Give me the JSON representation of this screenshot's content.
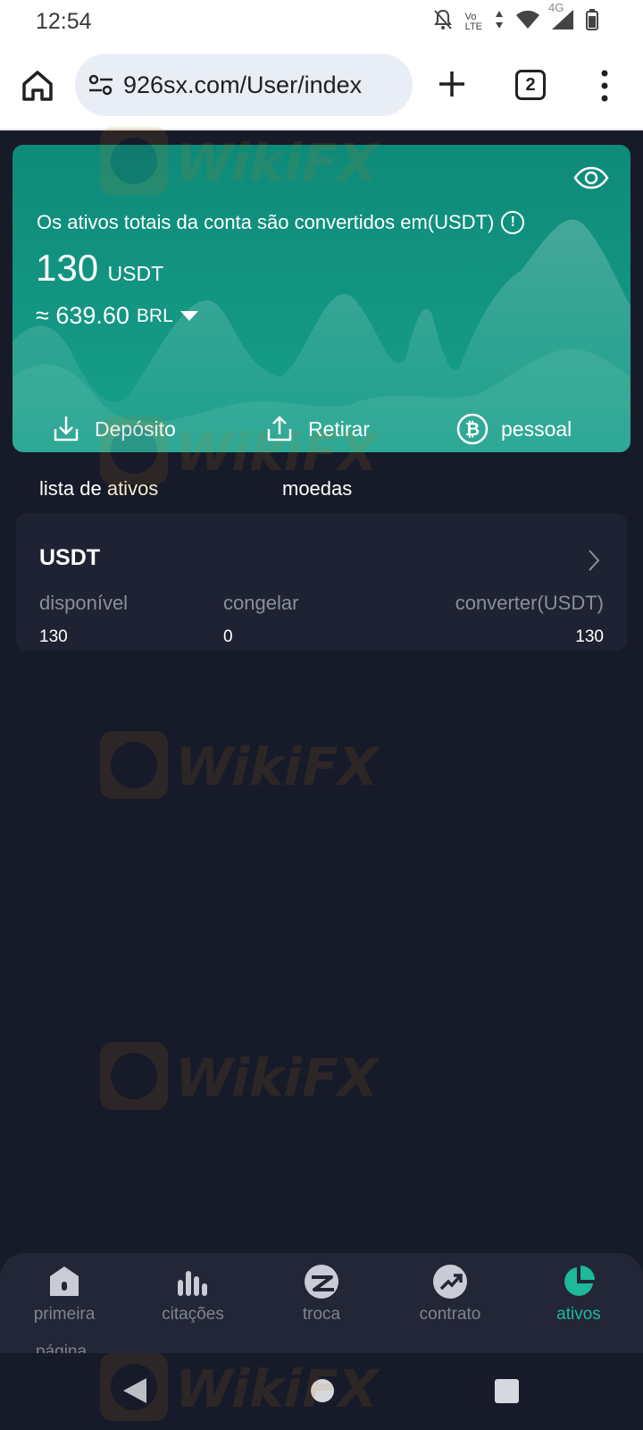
{
  "status_bar": {
    "time": "12:54",
    "icons": [
      "notifications-off-icon",
      "volte-icon",
      "data-arrows-icon",
      "wifi-icon",
      "cell-4g-icon",
      "battery-icon"
    ],
    "volte_line1": "Vo",
    "volte_line2": "LTE",
    "network_label": "4G"
  },
  "browser": {
    "url": "926sx.com/User/index",
    "tab_count": "2"
  },
  "asset_card": {
    "label": "Os ativos totais da conta são convertidos em(USDT)",
    "balance_value": "130",
    "balance_unit": "USDT",
    "fiat_value": "≈ 639.60",
    "fiat_unit": "BRL",
    "actions": [
      {
        "label": "Depósito",
        "icon": "download-icon"
      },
      {
        "label": "Retirar",
        "icon": "upload-icon"
      },
      {
        "label": "pessoal",
        "icon": "bitcoin-icon"
      }
    ],
    "accent_color": "#129582"
  },
  "tabs": [
    {
      "label_prefix": "lista de ",
      "label_highlight": "ativos",
      "active": true
    },
    {
      "label": "moedas",
      "active": false
    }
  ],
  "assets": [
    {
      "coin": "USDT",
      "columns": [
        {
          "label": "disponível",
          "value": "130"
        },
        {
          "label": "congelar",
          "value": "0"
        },
        {
          "label": "converter(USDT)",
          "value": "130"
        }
      ]
    }
  ],
  "bottom_nav": {
    "items": [
      {
        "label": "primeira",
        "icon": "home-icon",
        "active": false
      },
      {
        "label": "citações",
        "icon": "bar-chart-icon",
        "active": false
      },
      {
        "label": "troca",
        "icon": "exchange-icon",
        "active": false
      },
      {
        "label": "contrato",
        "icon": "trend-up-icon",
        "active": false
      },
      {
        "label": "ativos",
        "icon": "pie-chart-icon",
        "active": true
      }
    ],
    "overflow_label": "página",
    "active_color": "#1eb89a"
  },
  "watermark_text": "WikiFX"
}
